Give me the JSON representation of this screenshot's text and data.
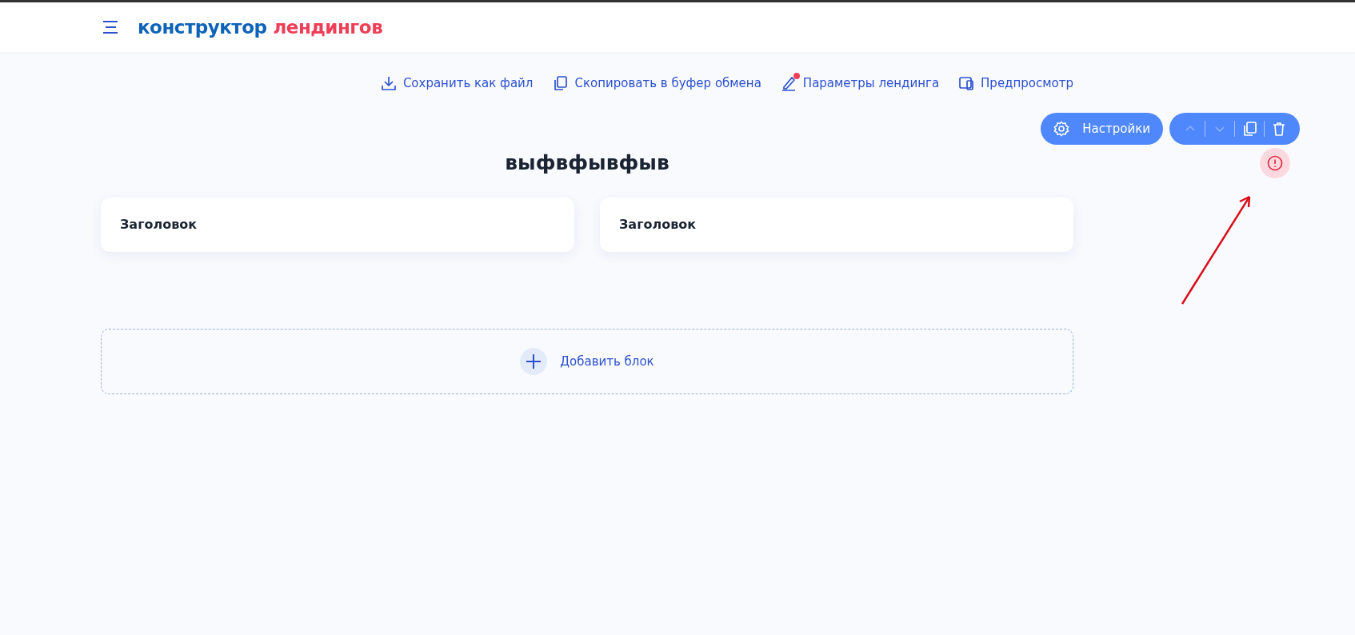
{
  "header": {
    "logo": {
      "part_1": "конструктор",
      "part_2": "лендингов"
    }
  },
  "toolbar": [
    {
      "kind": "download",
      "label": "Сохранить как файл",
      "has_dot": false
    },
    {
      "kind": "copy",
      "label": "Скопировать в буфер обмена",
      "has_dot": false
    },
    {
      "kind": "edit",
      "label": "Параметры лендинга",
      "has_dot": true
    },
    {
      "kind": "preview",
      "label": "Предпросмотр",
      "has_dot": false
    }
  ],
  "block_controls": {
    "settings_label": "Настройки",
    "actions": [
      {
        "kind": "up",
        "disabled": true
      },
      {
        "kind": "down",
        "disabled": true
      },
      {
        "kind": "copy",
        "disabled": false
      },
      {
        "kind": "delete",
        "disabled": false
      }
    ],
    "has_error": true
  },
  "block": {
    "title": "выфвфывфыв",
    "cards": [
      {
        "title": "Заголовок"
      },
      {
        "title": "Заголовок"
      }
    ]
  },
  "add_block": {
    "label": "Добавить блок"
  }
}
